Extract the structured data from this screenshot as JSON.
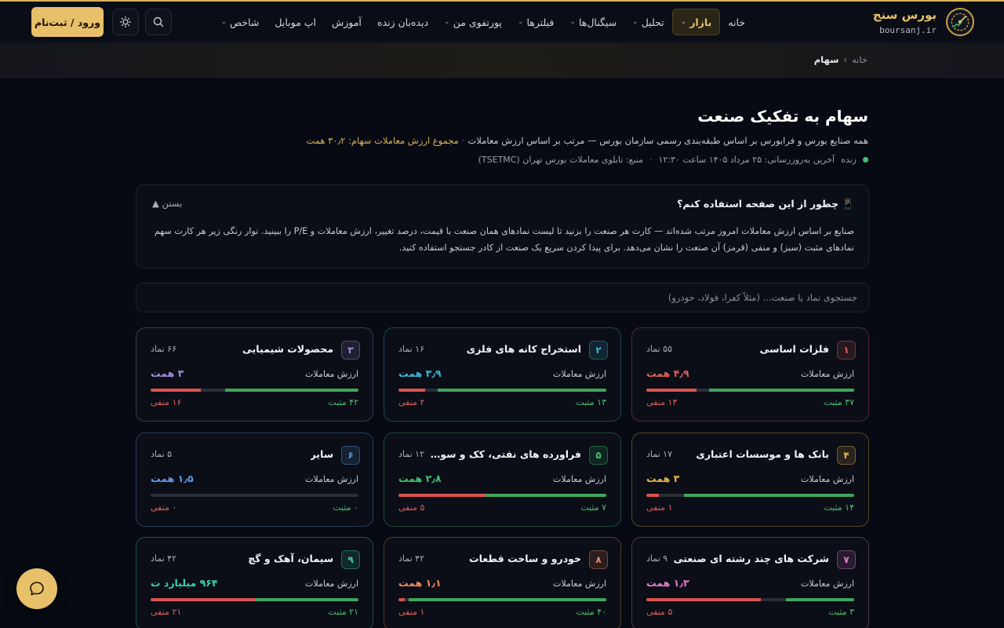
{
  "brand": {
    "name": "بورس سنج",
    "domain": "boursanj.ir"
  },
  "nav": [
    {
      "label": "خانه",
      "dropdown": false,
      "active": false
    },
    {
      "label": "بازار",
      "dropdown": true,
      "active": true
    },
    {
      "label": "تحلیل",
      "dropdown": true,
      "active": false
    },
    {
      "label": "سیگنال‌ها",
      "dropdown": true,
      "active": false
    },
    {
      "label": "فیلترها",
      "dropdown": true,
      "active": false
    },
    {
      "label": "پورتفوی من",
      "dropdown": true,
      "active": false
    },
    {
      "label": "دیده‌بان زنده",
      "dropdown": false,
      "active": false
    },
    {
      "label": "آموزش",
      "dropdown": false,
      "active": false
    },
    {
      "label": "اپ موبایل",
      "dropdown": false,
      "active": false
    },
    {
      "label": "شاخص",
      "dropdown": true,
      "active": false
    }
  ],
  "header": {
    "login_label": "ورود / ثبت‌نام"
  },
  "breadcrumb": {
    "home": "خانه",
    "separator": "‹",
    "current": "سهام"
  },
  "page": {
    "title": "سهام به تفکیک صنعت",
    "subtitle": "همه صنایع بورس و فرابورس بر اساس طبقه‌بندی رسمی سازمان بورس — مرتب بر اساس ارزش معاملات",
    "total_label": "مجموع ارزش معاملات سهام: ۳۰٫۲ همت",
    "live_label": "زنده",
    "updated": "آخرین به‌روزرسانی: ۲۵ مرداد ۱۴۰۵ ساعت ۱۲:۳۰",
    "source": "منبع: تابلوی معاملات بورس تهران (TSETMC)"
  },
  "help": {
    "title": "📱 چطور از این صفحه استفاده کنم؟",
    "close_label": "بستن ▲",
    "body": "صنایع بر اساس ارزش معاملات امروز مرتب شده‌اند — کارت هر صنعت را بزنید تا لیست نمادهای همان صنعت با قیمت، درصد تغییر، ارزش معاملات و P/E را ببینید. نوار رنگی زیر هر کارت سهم نمادهای مثبت (سبز) و منفی (قرمز) آن صنعت را نشان می‌دهد. برای پیدا کردن سریع یک صنعت از کادر جستجو استفاده کنید."
  },
  "search": {
    "placeholder": "جستجوی نماد یا صنعت... (مثلاً کفرا، فولاد، خودرو)"
  },
  "value_label": "ارزش معاملات",
  "industries": [
    {
      "rank": "۱",
      "name": "فلزات اساسی",
      "count": "۵۵ نماد",
      "value": "۴٫۹ همت",
      "positive": "۳۷ مثبت",
      "negative": "۱۳ منفی",
      "pos_frac": 0.7,
      "neg_frac": 0.24,
      "accent": "#e0605b"
    },
    {
      "rank": "۲",
      "name": "استخراج کانه های فلزی",
      "count": "۱۶ نماد",
      "value": "۳٫۹ همت",
      "positive": "۱۳ مثبت",
      "negative": "۲ منفی",
      "pos_frac": 0.81,
      "neg_frac": 0.13,
      "accent": "#3ab6d6"
    },
    {
      "rank": "۳",
      "name": "محصولات شیمیایی",
      "count": "۶۶ نماد",
      "value": "۳ همت",
      "positive": "۴۲ مثبت",
      "negative": "۱۶ منفی",
      "pos_frac": 0.64,
      "neg_frac": 0.24,
      "accent": "#a58be0"
    },
    {
      "rank": "۴",
      "name": "بانک ها و موسسات اعتباری",
      "count": "۱۷ نماد",
      "value": "۳ همت",
      "positive": "۱۴ مثبت",
      "negative": "۱ منفی",
      "pos_frac": 0.82,
      "neg_frac": 0.06,
      "accent": "#e8b64a"
    },
    {
      "rank": "۵",
      "name": "فراورده های نفتی، کک و سوخت هسته‌ای",
      "count": "۱۲ نماد",
      "value": "۲٫۸ همت",
      "positive": "۷ مثبت",
      "negative": "۵ منفی",
      "pos_frac": 0.58,
      "neg_frac": 0.42,
      "accent": "#3fc46f"
    },
    {
      "rank": "۶",
      "name": "سایر",
      "count": "۵ نماد",
      "value": "۱٫۵ همت",
      "positive": "۰ مثبت",
      "negative": "۰ منفی",
      "pos_frac": 0,
      "neg_frac": 0,
      "accent": "#5b9be8"
    },
    {
      "rank": "۷",
      "name": "شرکت های چند رشته ای صنعتی",
      "count": "۹ نماد",
      "value": "۱٫۳ همت",
      "positive": "۳ مثبت",
      "negative": "۵ منفی",
      "pos_frac": 0.33,
      "neg_frac": 0.55,
      "accent": "#e27bd0"
    },
    {
      "rank": "۸",
      "name": "خودرو و ساخت قطعات",
      "count": "۴۲ نماد",
      "value": "۱٫۱ همت",
      "positive": "۴۰ مثبت",
      "negative": "۱ منفی",
      "pos_frac": 0.95,
      "neg_frac": 0.03,
      "accent": "#f08a5d"
    },
    {
      "rank": "۹",
      "name": "سیمان، آهک و گچ",
      "count": "۴۲ نماد",
      "value": "۹۶۴ میلیارد ت",
      "positive": "۲۱ مثبت",
      "negative": "۲۱ منفی",
      "pos_frac": 0.5,
      "neg_frac": 0.5,
      "accent": "#38d3a8"
    }
  ]
}
